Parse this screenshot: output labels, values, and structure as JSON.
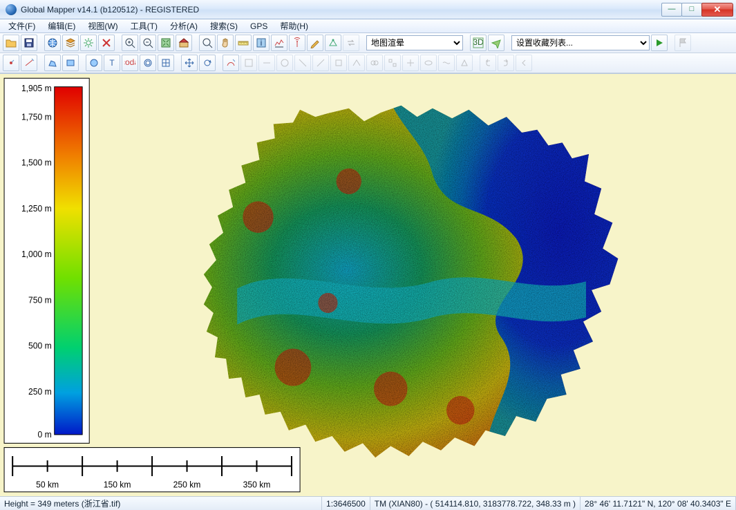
{
  "window": {
    "title": "Global Mapper v14.1 (b120512) - REGISTERED"
  },
  "menu": {
    "file": "文件(F)",
    "edit": "编辑(E)",
    "view": "视图(W)",
    "tools": "工具(T)",
    "analysis": "分析(A)",
    "search": "搜索(S)",
    "gps": "GPS",
    "help": "帮助(H)"
  },
  "toolbar1": {
    "map_layer_combo": "地图渲晕",
    "favorites_combo": "设置收藏列表..."
  },
  "legend": {
    "labels": [
      "1,905 m",
      "1,750 m",
      "1,500 m",
      "1,250 m",
      "1,000 m",
      "750 m",
      "500 m",
      "250 m",
      "0 m"
    ],
    "max": 1905,
    "min": 0
  },
  "scalebar": {
    "labels": [
      "50 km",
      "150 km",
      "250 km",
      "350 km"
    ]
  },
  "status": {
    "height": "Height = 349 meters (浙江省.tif)",
    "scale": "1:3646500",
    "proj": "TM (XIAN80) - ( 514114.810, 3183778.722, 348.33 m )",
    "latlon": "28° 46' 11.7121\" N, 120° 08' 40.3403\" E"
  }
}
